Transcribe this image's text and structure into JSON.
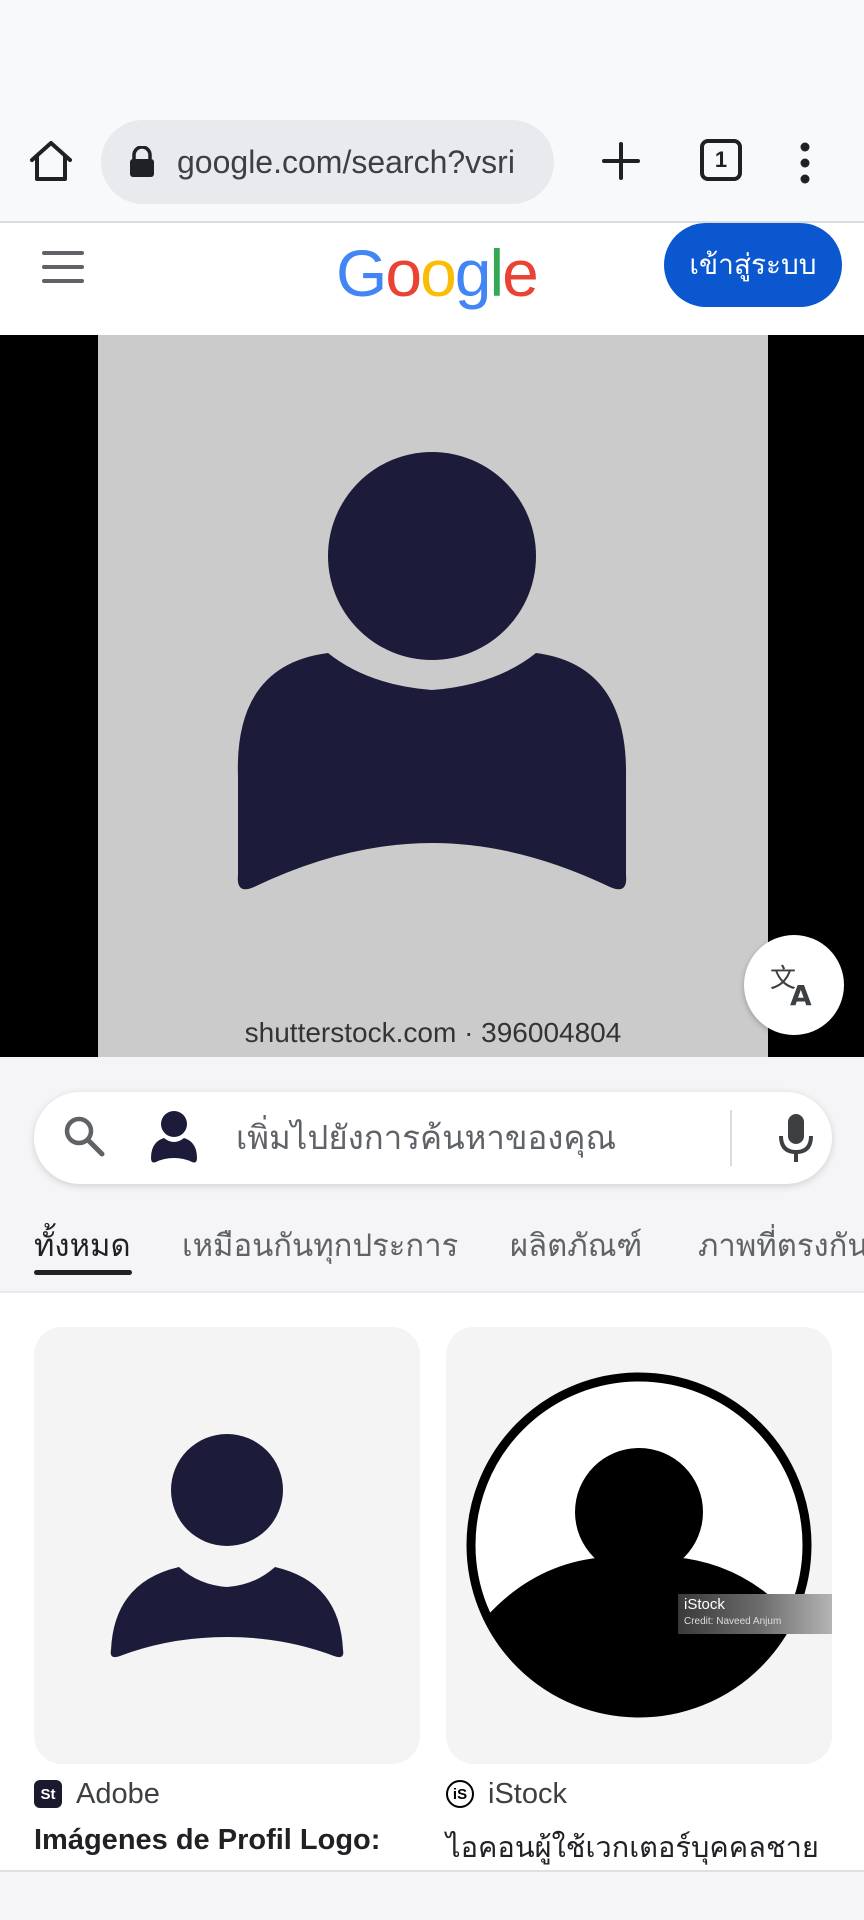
{
  "browser": {
    "url": "google.com/search?vsri",
    "tab_count": "1"
  },
  "header": {
    "logo_letters": [
      {
        "char": "G",
        "color": "#4285F4"
      },
      {
        "char": "o",
        "color": "#EA4335"
      },
      {
        "char": "o",
        "color": "#FBBC05"
      },
      {
        "char": "g",
        "color": "#4285F4"
      },
      {
        "char": "l",
        "color": "#34A853"
      },
      {
        "char": "e",
        "color": "#EA4335"
      }
    ],
    "signin_label": "เข้าสู่ระบบ",
    "signin_color": "#0b57d0"
  },
  "viewer": {
    "watermark": "shutterstock.com · 396004804",
    "silhouette_color": "#1c1c3a"
  },
  "search": {
    "placeholder": "เพิ่มไปยังการค้นหาของคุณ"
  },
  "tabs": [
    {
      "label": "ทั้งหมด",
      "active": true
    },
    {
      "label": "เหมือนกันทุกประการ",
      "active": false
    },
    {
      "label": "ผลิตภัณฑ์",
      "active": false
    },
    {
      "label": "ภาพที่ตรงกัน",
      "active": false
    }
  ],
  "results": [
    {
      "source": "Adobe",
      "source_icon_text": "St",
      "title": "Imágenes de Profil Logo:"
    },
    {
      "source": "iStock",
      "source_icon_text": "iS",
      "title": "ไอคอนผู้ใช้เวกเตอร์บุคคลชาย",
      "watermark_brand": "iStock",
      "watermark_credit": "Credit: Naveed Anjum"
    }
  ]
}
